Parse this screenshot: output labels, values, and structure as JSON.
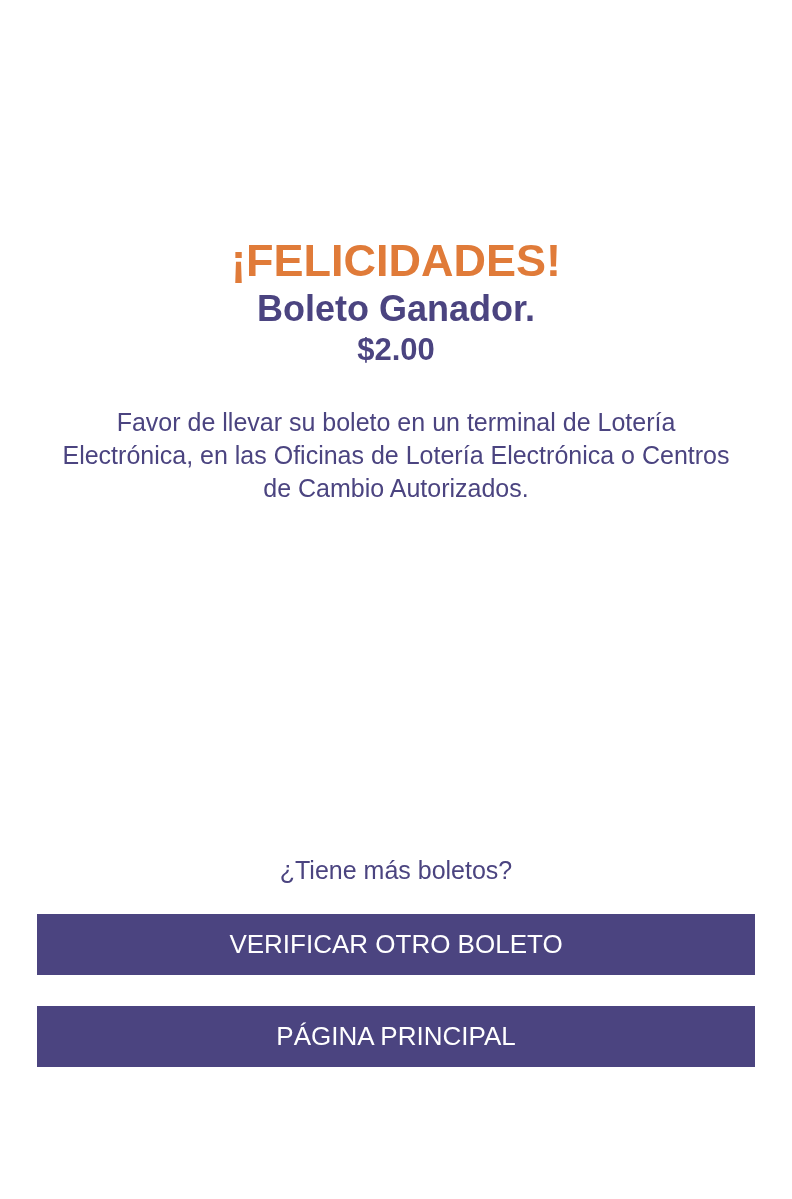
{
  "result": {
    "title": "¡FELICIDADES!",
    "subtitle": "Boleto Ganador.",
    "amount": "$2.00",
    "message": "Favor de llevar su boleto en un terminal de Lotería Electrónica, en las Oficinas de Lotería Electrónica o Centros de Cambio Autorizados."
  },
  "prompt": "¿Tiene más boletos?",
  "buttons": [
    "VERIFICAR OTRO BOLETO",
    "PÁGINA PRINCIPAL"
  ]
}
